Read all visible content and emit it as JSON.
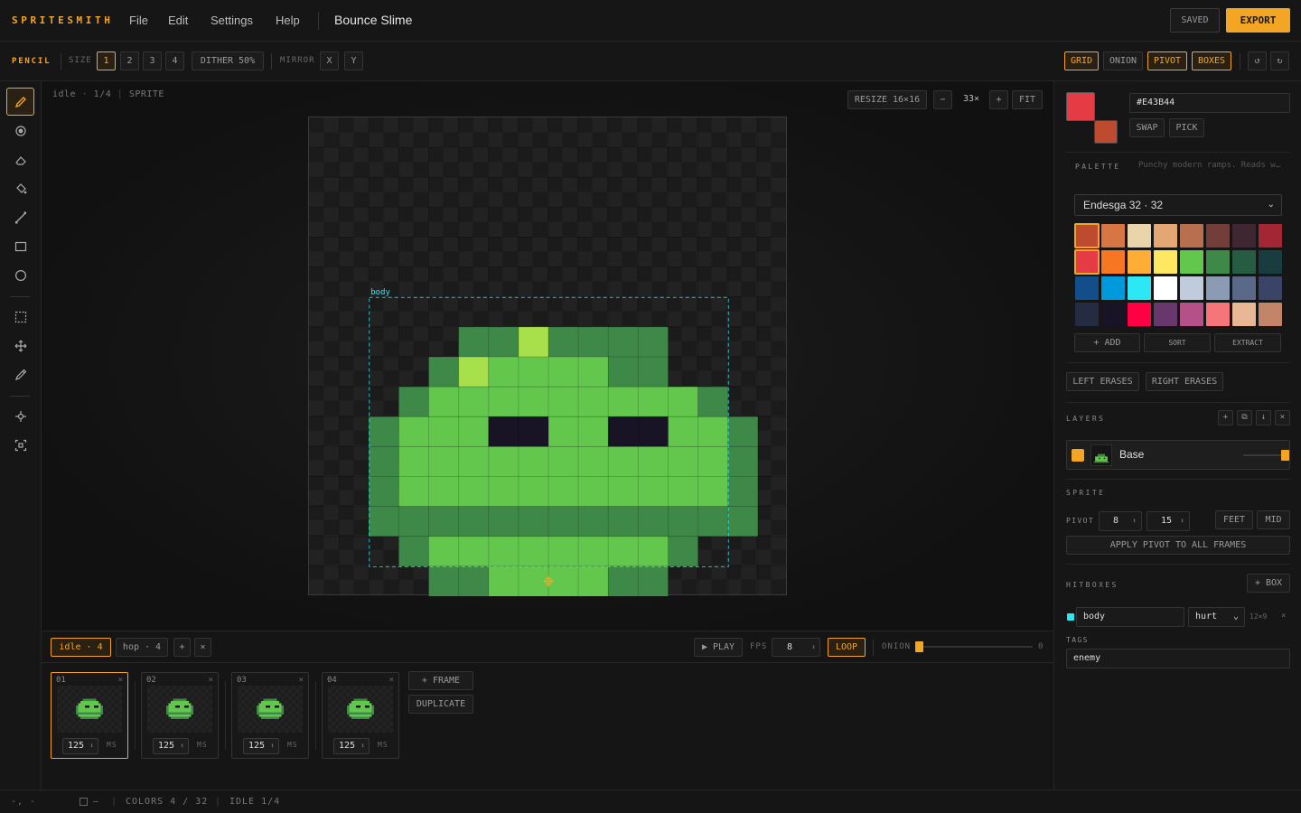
{
  "app": {
    "name": "SPRITESMITH",
    "project_title": "Bounce Slime"
  },
  "menu": [
    "File",
    "Edit",
    "Settings",
    "Help"
  ],
  "header": {
    "saved_label": "SAVED",
    "export_label": "EXPORT"
  },
  "tool_options": {
    "tool_name": "PENCIL",
    "size_label": "SIZE",
    "sizes": [
      "1",
      "2",
      "3",
      "4"
    ],
    "selected_size": "1",
    "dither_label": "DITHER 50%",
    "mirror_label": "MIRROR",
    "mirror_x": "X",
    "mirror_y": "Y",
    "view_toggles": [
      {
        "label": "GRID",
        "on": true
      },
      {
        "label": "ONION",
        "on": false
      },
      {
        "label": "PIVOT",
        "on": true
      },
      {
        "label": "BOXES",
        "on": true
      }
    ],
    "undo_icon": "undo-icon",
    "redo_icon": "redo-icon"
  },
  "tools": [
    {
      "name": "pencil-icon",
      "active": true
    },
    {
      "name": "brush-icon",
      "active": false
    },
    {
      "name": "eraser-icon",
      "active": false
    },
    {
      "name": "fill-icon",
      "active": false
    },
    {
      "name": "line-icon",
      "active": false
    },
    {
      "name": "rectangle-icon",
      "active": false
    },
    {
      "name": "ellipse-icon",
      "active": false
    },
    {
      "name": "select-icon",
      "active": false
    },
    {
      "name": "move-icon",
      "active": false
    },
    {
      "name": "eyedropper-icon",
      "active": false
    },
    {
      "name": "pivot-icon",
      "active": false
    },
    {
      "name": "hitbox-icon",
      "active": false
    }
  ],
  "canvas": {
    "crumb_anim": "idle",
    "crumb_frame": "1/4",
    "crumb_kind": "SPRITE",
    "resize_label": "RESIZE 16×16",
    "zoom_out": "−",
    "zoom_value": "33×",
    "zoom_in": "+",
    "fit_label": "FIT",
    "hitbox_label": "body",
    "grid_size": 16,
    "pixels": [
      {
        "row": 7,
        "cols": [
          5,
          6
        ],
        "color": "dark"
      },
      {
        "row": 7,
        "cols": [
          7,
          7
        ],
        "color": "lime"
      },
      {
        "row": 7,
        "cols": [
          8,
          11
        ],
        "color": "dark"
      },
      {
        "row": 8,
        "cols": [
          4,
          4
        ],
        "color": "dark"
      },
      {
        "row": 8,
        "cols": [
          5,
          5
        ],
        "color": "lime"
      },
      {
        "row": 8,
        "cols": [
          6,
          9
        ],
        "color": "mid"
      },
      {
        "row": 8,
        "cols": [
          10,
          11
        ],
        "color": "dark"
      },
      {
        "row": 9,
        "cols": [
          3,
          3
        ],
        "color": "dark"
      },
      {
        "row": 9,
        "cols": [
          4,
          12
        ],
        "color": "mid"
      },
      {
        "row": 9,
        "cols": [
          13,
          13
        ],
        "color": "dark"
      },
      {
        "row": 10,
        "cols": [
          2,
          2
        ],
        "color": "dark"
      },
      {
        "row": 10,
        "cols": [
          3,
          5
        ],
        "color": "mid"
      },
      {
        "row": 10,
        "cols": [
          6,
          7
        ],
        "color": "eye"
      },
      {
        "row": 10,
        "cols": [
          8,
          9
        ],
        "color": "mid"
      },
      {
        "row": 10,
        "cols": [
          10,
          11
        ],
        "color": "eye"
      },
      {
        "row": 10,
        "cols": [
          12,
          13
        ],
        "color": "mid"
      },
      {
        "row": 10,
        "cols": [
          14,
          14
        ],
        "color": "dark"
      },
      {
        "row": 11,
        "cols": [
          2,
          2
        ],
        "color": "dark"
      },
      {
        "row": 11,
        "cols": [
          3,
          13
        ],
        "color": "mid"
      },
      {
        "row": 11,
        "cols": [
          14,
          14
        ],
        "color": "dark"
      },
      {
        "row": 12,
        "cols": [
          2,
          2
        ],
        "color": "dark"
      },
      {
        "row": 12,
        "cols": [
          3,
          13
        ],
        "color": "mid"
      },
      {
        "row": 12,
        "cols": [
          14,
          14
        ],
        "color": "dark"
      },
      {
        "row": 13,
        "cols": [
          2,
          14
        ],
        "color": "dark"
      },
      {
        "row": 14,
        "cols": [
          3,
          3
        ],
        "color": "dark"
      },
      {
        "row": 14,
        "cols": [
          4,
          11
        ],
        "color": "mid"
      },
      {
        "row": 14,
        "cols": [
          12,
          12
        ],
        "color": "dark"
      },
      {
        "row": 15,
        "cols": [
          4,
          5
        ],
        "color": "dark"
      },
      {
        "row": 15,
        "cols": [
          6,
          9
        ],
        "color": "mid"
      },
      {
        "row": 15,
        "cols": [
          10,
          11
        ],
        "color": "dark"
      }
    ],
    "pixel_colors": {
      "dark": "#3E8948",
      "mid": "#63C74D",
      "lime": "#A8E04B",
      "eye": "#181425"
    },
    "hitbox": {
      "x": 2,
      "y": 6,
      "w": 12,
      "h": 9
    },
    "pivot": {
      "x": 8,
      "y": 15
    }
  },
  "timeline": {
    "animations": [
      {
        "name": "idle",
        "count": "4",
        "active": true
      },
      {
        "name": "hop",
        "count": "4",
        "active": false
      }
    ],
    "add_anim": "+",
    "delete_anim": "×",
    "play_label": "▶ PLAY",
    "fps_label": "FPS",
    "fps_value": "8",
    "loop_label": "LOOP",
    "onion_label": "ONION",
    "onion_value": "0",
    "frames": [
      {
        "num": "01",
        "duration": "125",
        "active": true
      },
      {
        "num": "02",
        "duration": "125",
        "active": false
      },
      {
        "num": "03",
        "duration": "125",
        "active": false
      },
      {
        "num": "04",
        "duration": "125",
        "active": false
      }
    ],
    "ms_label": "MS",
    "add_frame": "+ FRAME",
    "duplicate": "DUPLICATE"
  },
  "color": {
    "primary": "#E43B44",
    "secondary": "#BE4A2F",
    "hex_value": "#E43B44",
    "swap_label": "SWAP",
    "pick_label": "PICK"
  },
  "palette": {
    "label": "PALETTE",
    "description": "Punchy modern ramps. Reads w…",
    "selected": "Endesga 32 · 32",
    "swatches": [
      "#BE4A2F",
      "#D77643",
      "#EAD4AA",
      "#E4A672",
      "#B86F50",
      "#733E39",
      "#3E2731",
      "#A22633",
      "#E43B44",
      "#F77622",
      "#FEAE34",
      "#FEE761",
      "#63C74D",
      "#3E8948",
      "#265C42",
      "#193C3E",
      "#124E89",
      "#0099DB",
      "#2CE8F5",
      "#FFFFFF",
      "#C0CBDC",
      "#8B9BB4",
      "#5A6988",
      "#3A4466",
      "#262B44",
      "#181425",
      "#FF0044",
      "#68386C",
      "#B55088",
      "#F6757A",
      "#E8B796",
      "#C28569"
    ],
    "selected_swatch_indices": [
      0,
      8
    ],
    "add_label": "+ ADD",
    "sort_label": "SORT",
    "extract_label": "EXTRACT",
    "left_erases": "LEFT ERASES",
    "right_erases": "RIGHT ERASES"
  },
  "layers": {
    "label": "LAYERS",
    "items": [
      {
        "name": "Base",
        "color": "#F5A524",
        "opacity": 1.0
      }
    ]
  },
  "sprite": {
    "label": "SPRITE",
    "pivot_label": "PIVOT",
    "pivot_x": "8",
    "pivot_y": "15",
    "feet_label": "FEET",
    "mid_label": "MID",
    "apply_label": "APPLY PIVOT TO ALL FRAMES"
  },
  "hitboxes": {
    "label": "HITBOXES",
    "add_label": "+ BOX",
    "items": [
      {
        "name": "body",
        "type": "hurt",
        "size": "12×9",
        "color": "#2CE8F5"
      }
    ],
    "tags_label": "TAGS",
    "tags_value": "enemy"
  },
  "status": {
    "coords": "-, -",
    "selection": "—",
    "colors": "COLORS 4 / 32",
    "anim": "IDLE 1/4"
  }
}
